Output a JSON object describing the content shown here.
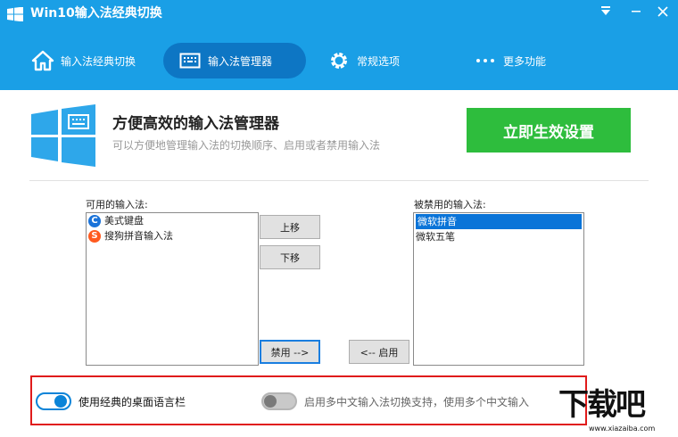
{
  "window": {
    "title": "Win10输入法经典切换",
    "menu_icon": "chevron-down-icon",
    "minimize_icon": "minimize-icon",
    "close_icon": "close-icon"
  },
  "nav": {
    "items": [
      {
        "label": "输入法经典切换",
        "icon": "home-icon"
      },
      {
        "label": "输入法管理器",
        "icon": "keyboard-icon",
        "active": true
      },
      {
        "label": "常规选项",
        "icon": "gear-icon"
      },
      {
        "label": "更多功能",
        "icon": "more-dots-icon"
      }
    ]
  },
  "header": {
    "title": "方便高效的输入法管理器",
    "subtitle": "可以方便地管理输入法的切换顺序、启用或者禁用输入法",
    "apply_button": "立即生效设置"
  },
  "available": {
    "label": "可用的输入法:",
    "items": [
      {
        "name": "美式键盘",
        "badge": "C",
        "badge_color": "#1a73d9"
      },
      {
        "name": "搜狗拼音输入法",
        "badge": "S",
        "badge_color": "#ff5a1f"
      }
    ]
  },
  "disabled": {
    "label": "被禁用的输入法:",
    "items": [
      {
        "name": "微软拼音",
        "selected": true
      },
      {
        "name": "微软五笔",
        "selected": false
      }
    ]
  },
  "buttons": {
    "move_up": "上移",
    "move_down": "下移",
    "disable": "禁用 -->",
    "enable": "<-- 启用"
  },
  "options": {
    "classic_langbar": {
      "label": "使用经典的桌面语言栏",
      "on": true
    },
    "multi_chinese": {
      "label": "启用多中文输入法切换支持，使用多个中文输入",
      "on": false
    }
  },
  "watermark": {
    "main": "下载吧",
    "url": "www.xiazaiba.com"
  },
  "colors": {
    "accent": "#1a9fe6",
    "nav_active": "#0d76c4",
    "apply": "#2ebd3d",
    "highlight_frame": "#e01b1b"
  }
}
